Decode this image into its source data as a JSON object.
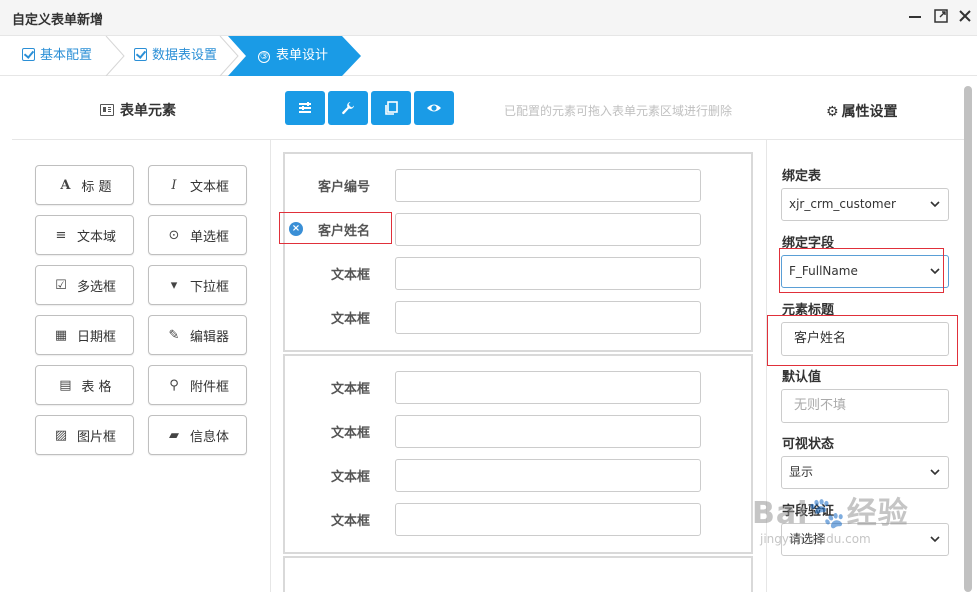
{
  "window": {
    "title": "自定义表单新增"
  },
  "steps": [
    {
      "label": "基本配置",
      "state": "done"
    },
    {
      "label": "数据表设置",
      "state": "done"
    },
    {
      "label": "表单设计",
      "number": "③",
      "state": "active"
    }
  ],
  "header": {
    "left_title": "表单元素",
    "hint": "已配置的元素可拖入表单元素区域进行删除",
    "right_title": "属性设置"
  },
  "toolbar": [
    {
      "icon": "list-icon"
    },
    {
      "icon": "wrench-icon"
    },
    {
      "icon": "copy-icon"
    },
    {
      "icon": "eye-icon"
    }
  ],
  "elements": [
    {
      "label": "标 题",
      "icon": "A"
    },
    {
      "label": "文本框",
      "icon": "I"
    },
    {
      "label": "文本域",
      "icon": "≡"
    },
    {
      "label": "单选框",
      "icon": "⊙"
    },
    {
      "label": "多选框",
      "icon": "☑"
    },
    {
      "label": "下拉框",
      "icon": "▾"
    },
    {
      "label": "日期框",
      "icon": "▦"
    },
    {
      "label": "编辑器",
      "icon": "✎"
    },
    {
      "label": "表 格",
      "icon": "▤"
    },
    {
      "label": "附件框",
      "icon": "⚲"
    },
    {
      "label": "图片框",
      "icon": "▨"
    },
    {
      "label": "信息体",
      "icon": "▰"
    }
  ],
  "form": {
    "section1": [
      "客户编号",
      "客户姓名",
      "文本框",
      "文本框"
    ],
    "section2": [
      "文本框",
      "文本框",
      "文本框",
      "文本框"
    ]
  },
  "properties": {
    "bind_table_label": "绑定表",
    "bind_table_value": "xjr_crm_customer",
    "bind_field_label": "绑定字段",
    "bind_field_value": "F_FullName",
    "element_title_label": "元素标题",
    "element_title_value": "客户姓名",
    "default_label": "默认值",
    "default_placeholder": "无则不填",
    "visible_label": "可视状态",
    "visible_value": "显示",
    "validate_label": "字段验证",
    "validate_value": "请选择"
  },
  "watermark": {
    "big": "Bai🐾经验",
    "small": "jingyan.baidu.com"
  },
  "colors": {
    "accent": "#1a9be6",
    "highlight": "#e0303a"
  }
}
